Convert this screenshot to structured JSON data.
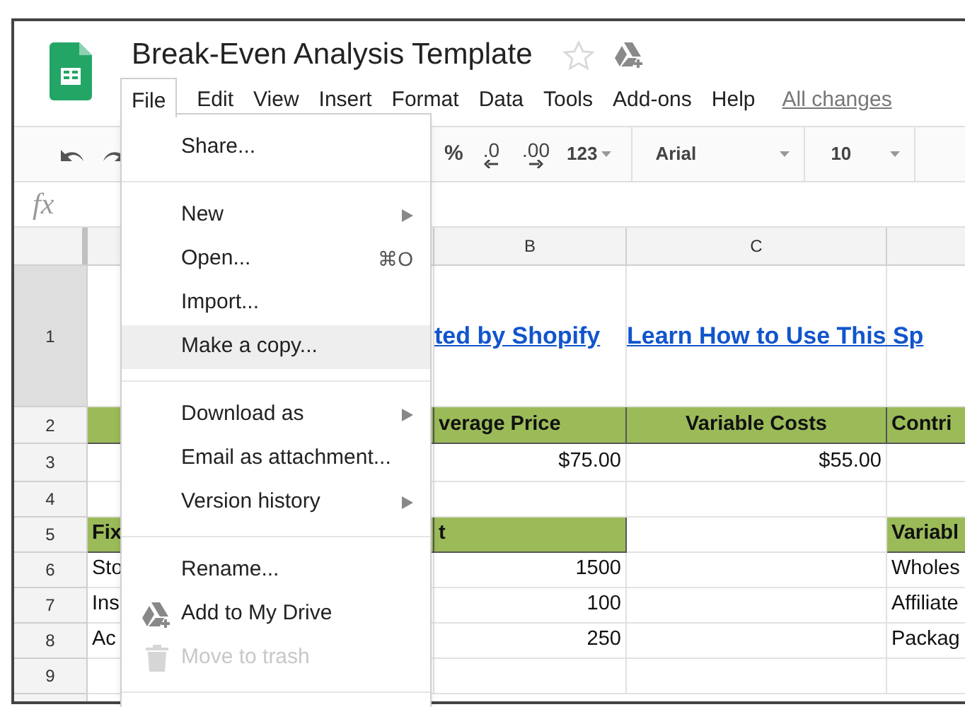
{
  "app": {
    "title": "Break-Even Analysis Template",
    "starred": false,
    "save_status": "All changes"
  },
  "menu_bar": [
    {
      "label": "File",
      "selected": true
    },
    {
      "label": "Edit",
      "selected": false
    },
    {
      "label": "View",
      "selected": false
    },
    {
      "label": "Insert",
      "selected": false
    },
    {
      "label": "Format",
      "selected": false
    },
    {
      "label": "Data",
      "selected": false
    },
    {
      "label": "Tools",
      "selected": false
    },
    {
      "label": "Add-ons",
      "selected": false
    },
    {
      "label": "Help",
      "selected": false
    }
  ],
  "toolbar": {
    "format_buttons": [
      "%",
      ".0",
      ".00",
      "123"
    ],
    "font": "Arial",
    "font_size": "10"
  },
  "formula_bar": {
    "label": "fx"
  },
  "sheet": {
    "column_headers": [
      "B",
      "C"
    ],
    "rows": [
      {
        "number": "1",
        "cells": [
          null,
          {
            "kind": "link",
            "text": "ted by Shopify"
          },
          {
            "kind": "link",
            "text": "Learn How to Use This Sp"
          },
          null
        ]
      },
      {
        "number": "2",
        "cells": [
          {
            "kind": "header"
          },
          {
            "kind": "header",
            "text": "verage Price"
          },
          {
            "kind": "header",
            "text": "Variable Costs"
          },
          {
            "kind": "header",
            "text": "Contri"
          }
        ]
      },
      {
        "number": "3",
        "cells": [
          null,
          {
            "kind": "number",
            "text": "$75.00"
          },
          {
            "kind": "number",
            "text": "$55.00"
          },
          null
        ]
      },
      {
        "number": "4",
        "cells": [
          null,
          null,
          null,
          null
        ]
      },
      {
        "number": "5",
        "cells": [
          {
            "kind": "header",
            "text": "Fix"
          },
          {
            "kind": "header",
            "text": "t"
          },
          null,
          {
            "kind": "header",
            "text": "Variabl"
          }
        ]
      },
      {
        "number": "6",
        "cells": [
          {
            "kind": "text",
            "text": "Sto"
          },
          {
            "kind": "number",
            "text": "1500"
          },
          null,
          {
            "kind": "text",
            "text": "Wholes"
          }
        ]
      },
      {
        "number": "7",
        "cells": [
          {
            "kind": "text",
            "text": "Ins"
          },
          {
            "kind": "number",
            "text": "100"
          },
          null,
          {
            "kind": "text",
            "text": "Affiliate"
          }
        ]
      },
      {
        "number": "8",
        "cells": [
          {
            "kind": "text",
            "text": "Ac"
          },
          {
            "kind": "number",
            "text": "250"
          },
          null,
          {
            "kind": "text",
            "text": "Packag"
          }
        ]
      },
      {
        "number": "9",
        "cells": [
          null,
          null,
          null,
          null
        ]
      }
    ]
  },
  "file_menu": {
    "groups": [
      [
        {
          "kind": "plain",
          "label": "Share...",
          "submenu": false,
          "selected": false,
          "disabled": false
        }
      ],
      [
        {
          "kind": "plain",
          "label": "New",
          "submenu": true,
          "selected": false,
          "disabled": false
        },
        {
          "kind": "plain",
          "label": "Open...",
          "shortcut": "⌘O",
          "submenu": false,
          "selected": false,
          "disabled": false
        },
        {
          "kind": "plain",
          "label": "Import...",
          "submenu": false,
          "selected": false,
          "disabled": false
        },
        {
          "kind": "plain",
          "label": "Make a copy...",
          "submenu": false,
          "selected": true,
          "disabled": false
        }
      ],
      [
        {
          "kind": "plain",
          "label": "Download as",
          "submenu": true,
          "selected": false,
          "disabled": false
        },
        {
          "kind": "plain",
          "label": "Email as attachment...",
          "submenu": false,
          "selected": false,
          "disabled": false
        },
        {
          "kind": "plain",
          "label": "Version history",
          "submenu": true,
          "selected": false,
          "disabled": false
        }
      ],
      [
        {
          "kind": "plain",
          "label": "Rename...",
          "submenu": false,
          "selected": false,
          "disabled": false
        },
        {
          "kind": "drive",
          "label": "Add to My Drive",
          "submenu": false,
          "selected": false,
          "disabled": false
        },
        {
          "kind": "trash",
          "label": "Move to trash",
          "submenu": false,
          "selected": false,
          "disabled": true
        }
      ]
    ]
  }
}
